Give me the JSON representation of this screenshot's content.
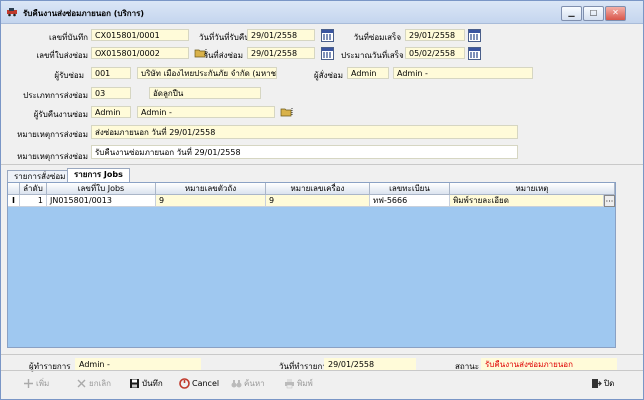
{
  "window": {
    "title": "รับคืนงานส่งซ่อมภายนอก (บริการ)",
    "controls": {
      "minimize": "▁",
      "maximize": "□",
      "close": "✕"
    }
  },
  "form": {
    "record_no": {
      "label": "เลขที่บันทึก",
      "value": "CX015801/0001"
    },
    "receive_date": {
      "label": "วันที่วันที่รับคืน",
      "value": "29/01/2558"
    },
    "finish_date": {
      "label": "วันที่ซ่อมเสร็จ",
      "value": "29/01/2558"
    },
    "send_doc_no": {
      "label": "เลขที่ใบส่งซ่อม",
      "value": "OX015801/0002"
    },
    "send_date": {
      "label": "วันที่ส่งซ่อม",
      "value": "29/01/2558"
    },
    "estimate_date": {
      "label": "ประมาณวันที่เสร็จ",
      "value": "05/02/2558"
    },
    "contractor": {
      "label": "ผู้รับซ่อม",
      "code": "001",
      "name": "บริษัท เมืองไทยประกันภัย จำกัด (มหาชน)"
    },
    "sender": {
      "label": "ผู้สั่งซ่อม",
      "code": "Admin",
      "name": "Admin -"
    },
    "repair_type": {
      "label": "ประเภทการส่งซ่อม",
      "code": "03",
      "name": "อัดลูกปืน"
    },
    "returner": {
      "label": "ผู้รับคืนงานซ่อม",
      "code": "Admin",
      "name": "Admin -"
    },
    "send_note": {
      "label": "หมายเหตุการส่งซ่อม",
      "value": "ส่งซ่อมภายนอก วันที่ 29/01/2558"
    },
    "return_note": {
      "label": "หมายเหตุการส่งซ่อม",
      "value": "รับคืนงานซ่อมภายนอก วันที่ 29/01/2558"
    }
  },
  "tabs": [
    {
      "label": "รายการสั่งซ่อม"
    },
    {
      "label": "รายการ Jobs"
    }
  ],
  "grid": {
    "columns": [
      "ลำดับ",
      "เลขที่ใบ Jobs",
      "หมายเลขตัวถัง",
      "หมายเลขเครื่อง",
      "เลขทะเบียน",
      "หมายเหตุ"
    ],
    "rows": [
      {
        "indicator": "I",
        "seq": "1",
        "job_no": "JN015801/0013",
        "chassis": "9",
        "engine": "9",
        "plate": "ทฟ-5666",
        "note": "พิมพ์รายละเอียด",
        "more": "···"
      }
    ]
  },
  "status": {
    "maker_label": "ผู้ทำรายการ",
    "maker_value": "Admin -",
    "date_label": "วันที่ทำรายการ",
    "date_value": "29/01/2558",
    "state_label": "สถานะ",
    "state_value": "รับคืนงานส่งซ่อมภายนอก",
    "state_color": "#e00000"
  },
  "toolbar": {
    "add": "เพิ่ม",
    "cancel_doc": "ยกเลิก",
    "save": "บันทึก",
    "cancel": "Cancel",
    "search": "ค้นหา",
    "print": "พิมพ์",
    "close": "ปิด"
  }
}
